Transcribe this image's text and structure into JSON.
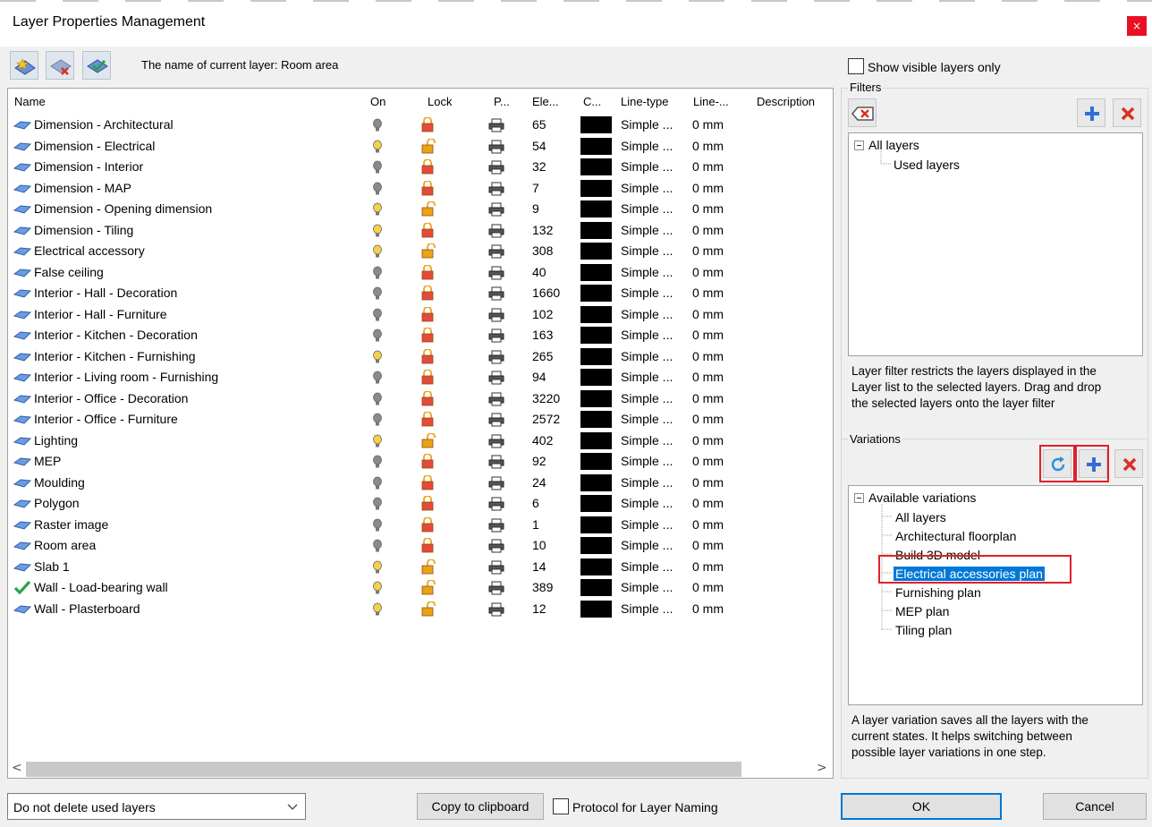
{
  "window": {
    "title": "Layer Properties Management",
    "close_glyph": "×"
  },
  "toolbar": {
    "current_layer_text": "The name of current layer: Room area",
    "buttons": [
      "new-layer-icon",
      "delete-layer-icon",
      "set-current-layer-icon"
    ]
  },
  "table": {
    "columns": [
      "Name",
      "On",
      "Lock",
      "P...",
      "Ele...",
      "C...",
      "Line-type",
      "Line-...",
      "Description"
    ],
    "rows": [
      {
        "name": "Dimension - Architectural",
        "on": false,
        "locked": true,
        "count": "65",
        "linetype": "Simple ...",
        "lineweight": "0 mm",
        "current": false
      },
      {
        "name": "Dimension - Electrical",
        "on": true,
        "locked": false,
        "count": "54",
        "linetype": "Simple ...",
        "lineweight": "0 mm",
        "current": false
      },
      {
        "name": "Dimension - Interior",
        "on": false,
        "locked": true,
        "count": "32",
        "linetype": "Simple ...",
        "lineweight": "0 mm",
        "current": false
      },
      {
        "name": "Dimension - MAP",
        "on": false,
        "locked": true,
        "count": "7",
        "linetype": "Simple ...",
        "lineweight": "0 mm",
        "current": false
      },
      {
        "name": "Dimension - Opening dimension",
        "on": true,
        "locked": false,
        "count": "9",
        "linetype": "Simple ...",
        "lineweight": "0 mm",
        "current": false
      },
      {
        "name": "Dimension - Tiling",
        "on": true,
        "locked": true,
        "count": "132",
        "linetype": "Simple ...",
        "lineweight": "0 mm",
        "current": false
      },
      {
        "name": "Electrical accessory",
        "on": true,
        "locked": false,
        "count": "308",
        "linetype": "Simple ...",
        "lineweight": "0 mm",
        "current": false
      },
      {
        "name": "False ceiling",
        "on": false,
        "locked": true,
        "count": "40",
        "linetype": "Simple ...",
        "lineweight": "0 mm",
        "current": false
      },
      {
        "name": "Interior - Hall - Decoration",
        "on": false,
        "locked": true,
        "count": "1660",
        "linetype": "Simple ...",
        "lineweight": "0 mm",
        "current": false
      },
      {
        "name": "Interior - Hall - Furniture",
        "on": false,
        "locked": true,
        "count": "102",
        "linetype": "Simple ...",
        "lineweight": "0 mm",
        "current": false
      },
      {
        "name": "Interior - Kitchen - Decoration",
        "on": false,
        "locked": true,
        "count": "163",
        "linetype": "Simple ...",
        "lineweight": "0 mm",
        "current": false
      },
      {
        "name": "Interior - Kitchen - Furnishing",
        "on": true,
        "locked": true,
        "count": "265",
        "linetype": "Simple ...",
        "lineweight": "0 mm",
        "current": false
      },
      {
        "name": "Interior - Living room - Furnishing",
        "on": false,
        "locked": true,
        "count": "94",
        "linetype": "Simple ...",
        "lineweight": "0 mm",
        "current": false
      },
      {
        "name": "Interior - Office - Decoration",
        "on": false,
        "locked": true,
        "count": "3220",
        "linetype": "Simple ...",
        "lineweight": "0 mm",
        "current": false
      },
      {
        "name": "Interior - Office - Furniture",
        "on": false,
        "locked": true,
        "count": "2572",
        "linetype": "Simple ...",
        "lineweight": "0 mm",
        "current": false
      },
      {
        "name": "Lighting",
        "on": true,
        "locked": false,
        "count": "402",
        "linetype": "Simple ...",
        "lineweight": "0 mm",
        "current": false
      },
      {
        "name": "MEP",
        "on": false,
        "locked": true,
        "count": "92",
        "linetype": "Simple ...",
        "lineweight": "0 mm",
        "current": false
      },
      {
        "name": "Moulding",
        "on": false,
        "locked": true,
        "count": "24",
        "linetype": "Simple ...",
        "lineweight": "0 mm",
        "current": false
      },
      {
        "name": "Polygon",
        "on": false,
        "locked": true,
        "count": "6",
        "linetype": "Simple ...",
        "lineweight": "0 mm",
        "current": false
      },
      {
        "name": "Raster image",
        "on": false,
        "locked": true,
        "count": "1",
        "linetype": "Simple ...",
        "lineweight": "0 mm",
        "current": false
      },
      {
        "name": "Room area",
        "on": false,
        "locked": true,
        "count": "10",
        "linetype": "Simple ...",
        "lineweight": "0 mm",
        "current": false
      },
      {
        "name": "Slab 1",
        "on": true,
        "locked": false,
        "count": "14",
        "linetype": "Simple ...",
        "lineweight": "0 mm",
        "current": false
      },
      {
        "name": "Wall - Load-bearing wall",
        "on": true,
        "locked": false,
        "count": "389",
        "linetype": "Simple ...",
        "lineweight": "0 mm",
        "current": true
      },
      {
        "name": "Wall - Plasterboard",
        "on": true,
        "locked": false,
        "count": "12",
        "linetype": "Simple ...",
        "lineweight": "0 mm",
        "current": false
      }
    ]
  },
  "scrollbar": {
    "left_glyph": "<",
    "right_glyph": ">"
  },
  "bottom": {
    "delete_option": "Do not delete used layers",
    "copy_label": "Copy to clipboard",
    "protocol_label": "Protocol for Layer Naming",
    "ok_label": "OK",
    "cancel_label": "Cancel"
  },
  "filters": {
    "show_visible_label": "Show visible layers only",
    "group_label": "Filters",
    "tree_root": "All layers",
    "tree_child": "Used layers",
    "description": [
      "Layer filter restricts the layers displayed in the",
      "Layer list to the selected layers. Drag and drop",
      "the selected layers onto the layer filter"
    ]
  },
  "variations": {
    "group_label": "Variations",
    "tree_root": "Available variations",
    "items": [
      "All layers",
      "Architectural floorplan",
      "Build 3D model",
      "Electrical accessories plan",
      "Furnishing plan",
      "MEP plan",
      "Tiling plan"
    ],
    "selected_index": 3,
    "description": [
      "A layer variation saves all the layers with the",
      "current states. It helps switching between",
      "possible layer variations in one step."
    ]
  },
  "colors": {
    "selection": "#0078d7",
    "highlight_frame": "#e0202a",
    "close_red": "#e81123",
    "bulb_on": "#f2d24a",
    "bulb_off": "#8a8a8a",
    "lock_closed": "#e34b3a",
    "lock_open": "#e8a317"
  }
}
